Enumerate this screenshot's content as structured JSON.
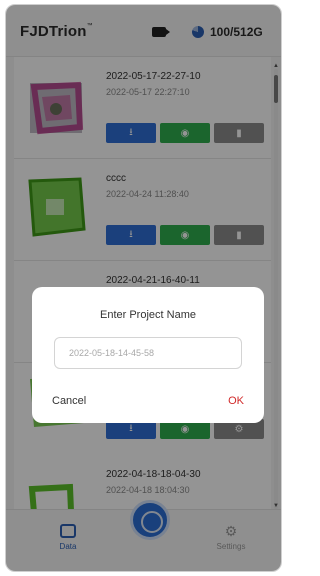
{
  "header": {
    "brand": "FJDTrion",
    "brand_tm": "™",
    "storage": "100/512G"
  },
  "items": [
    {
      "title": "2022-05-17-22-27-10",
      "subtitle": "2022-05-17 22:27:10",
      "thumb_color": "#b0207a"
    },
    {
      "title": "cccc",
      "subtitle": "2022-04-24 11:28:40",
      "thumb_color": "#5cc12a"
    },
    {
      "title": "2022-04-21-16-40-11",
      "subtitle": "",
      "thumb_color": "#5cc12a"
    },
    {
      "title": "",
      "subtitle": "",
      "thumb_color": "#5cc12a"
    },
    {
      "title": "2022-04-18-18-04-30",
      "subtitle": "2022-04-18 18:04:30",
      "thumb_color": "#5cc12a"
    }
  ],
  "item_buttons": {
    "download_icon": "download-icon",
    "view_icon": "eye-icon",
    "delete_icon": "trash-icon"
  },
  "nav": {
    "data_label": "Data",
    "settings_label": "Settings"
  },
  "dialog": {
    "title": "Enter Project Name",
    "input_placeholder": "2022-05-18-14-45-58",
    "cancel": "Cancel",
    "ok": "OK"
  },
  "colors": {
    "accent": "#2b6fd6",
    "view": "#2fae4f",
    "delete": "#8c8c8c",
    "ok": "#d12a2a"
  }
}
